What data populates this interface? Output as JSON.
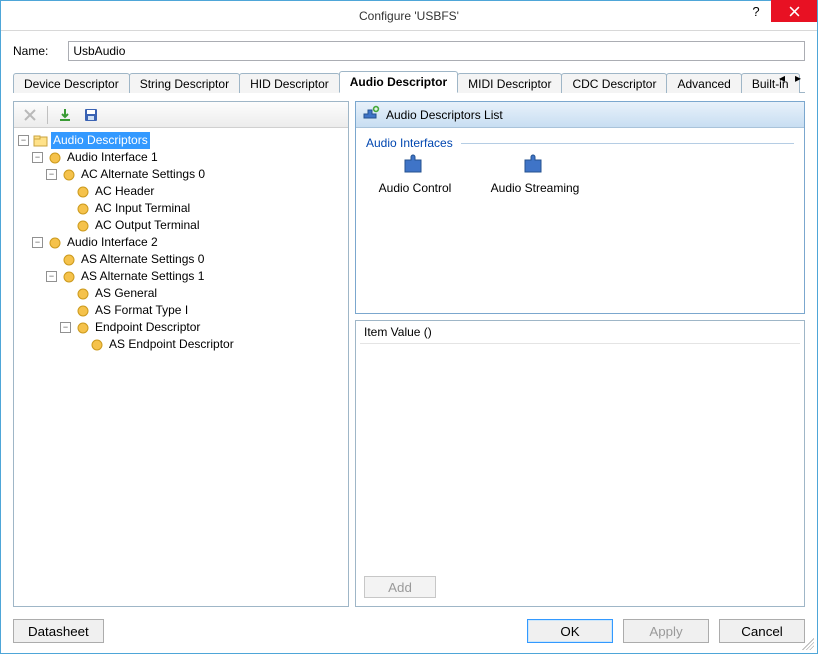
{
  "window": {
    "title": "Configure 'USBFS'"
  },
  "name": {
    "label": "Name:",
    "value": "UsbAudio"
  },
  "tabs": [
    {
      "label": "Device Descriptor"
    },
    {
      "label": "String Descriptor"
    },
    {
      "label": "HID Descriptor"
    },
    {
      "label": "Audio Descriptor",
      "active": true
    },
    {
      "label": "MIDI Descriptor"
    },
    {
      "label": "CDC Descriptor"
    },
    {
      "label": "Advanced"
    },
    {
      "label": "Built-in"
    }
  ],
  "tree": {
    "root": {
      "label": "Audio Descriptors",
      "selected": true
    },
    "if1": {
      "label": "Audio Interface 1",
      "alt0": {
        "label": "AC Alternate Settings 0",
        "h": "AC Header",
        "in": "AC Input Terminal",
        "out": "AC Output Terminal"
      }
    },
    "if2": {
      "label": "Audio Interface 2",
      "alt0": "AS Alternate Settings 0",
      "alt1": {
        "label": "AS Alternate Settings 1",
        "gen": "AS General",
        "fmt": "AS Format Type I",
        "ep": {
          "label": "Endpoint Descriptor",
          "asep": "AS Endpoint Descriptor"
        }
      }
    }
  },
  "list": {
    "title": "Audio Descriptors List",
    "group": "Audio Interfaces",
    "items": [
      {
        "label": "Audio Control"
      },
      {
        "label": "Audio Streaming"
      }
    ]
  },
  "itemValue": {
    "title": "Item Value ()",
    "addLabel": "Add"
  },
  "buttons": {
    "datasheet": "Datasheet",
    "ok": "OK",
    "apply": "Apply",
    "cancel": "Cancel"
  }
}
